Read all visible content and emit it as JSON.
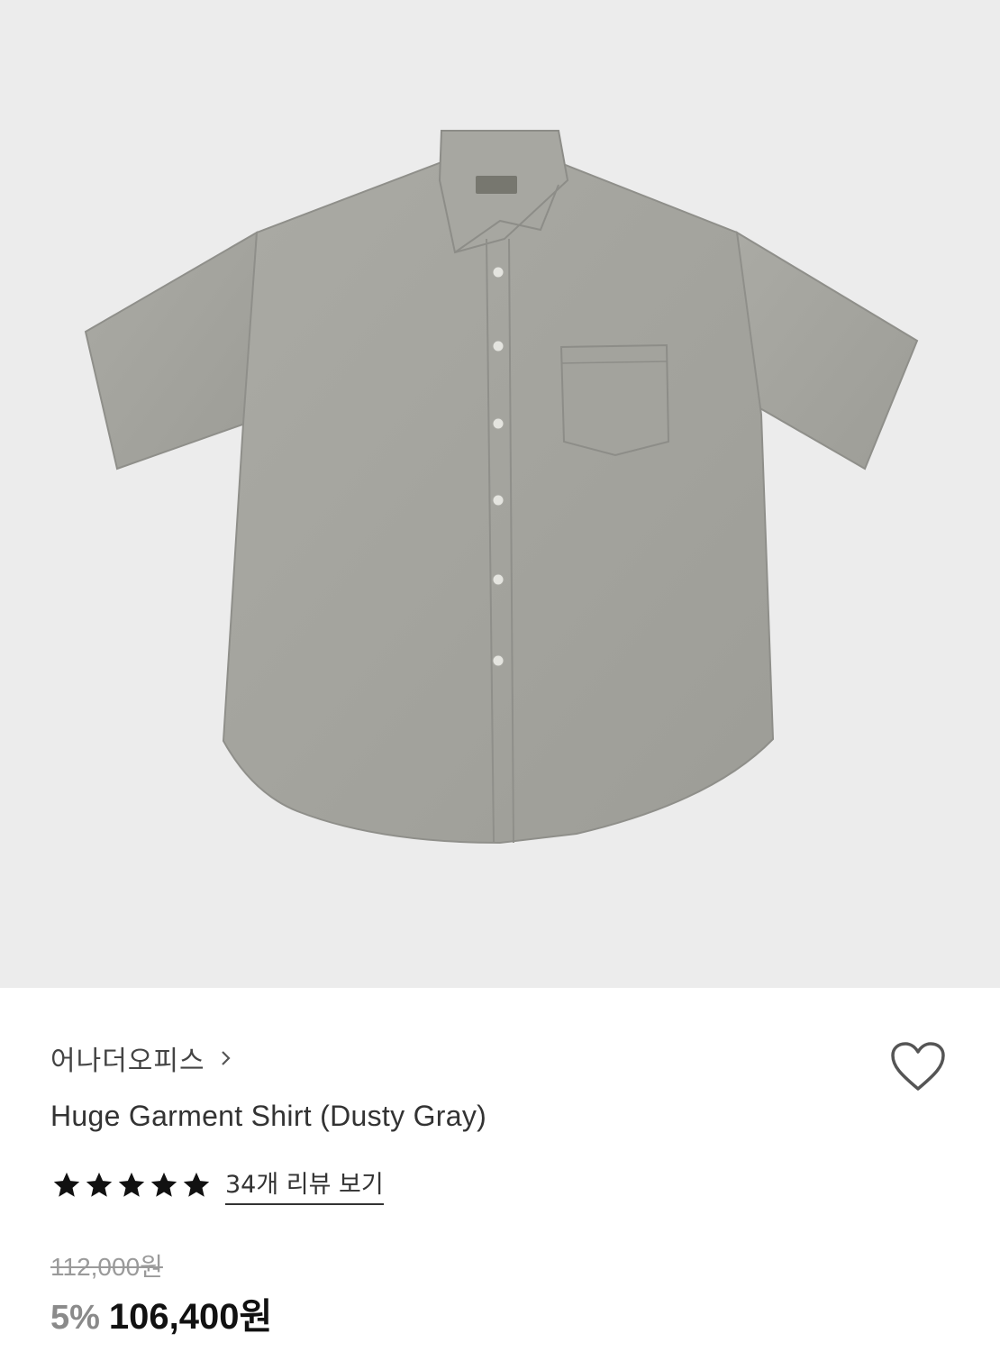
{
  "product": {
    "image_alt": "Huge Garment Shirt (Dusty Gray)",
    "shirt_color": "#a4a49e",
    "background_color": "#ececec",
    "brand": "어나더오피스",
    "brand_chevron": "›",
    "name": "Huge Garment Shirt (Dusty Gray)",
    "rating": {
      "stars": 5,
      "max": 5
    },
    "review_link": "34개 리뷰 보기",
    "original_price": "112,000원",
    "discount": "5%",
    "sale_price": "106,400원",
    "wishlist_icon": "heart-outline-icon"
  }
}
